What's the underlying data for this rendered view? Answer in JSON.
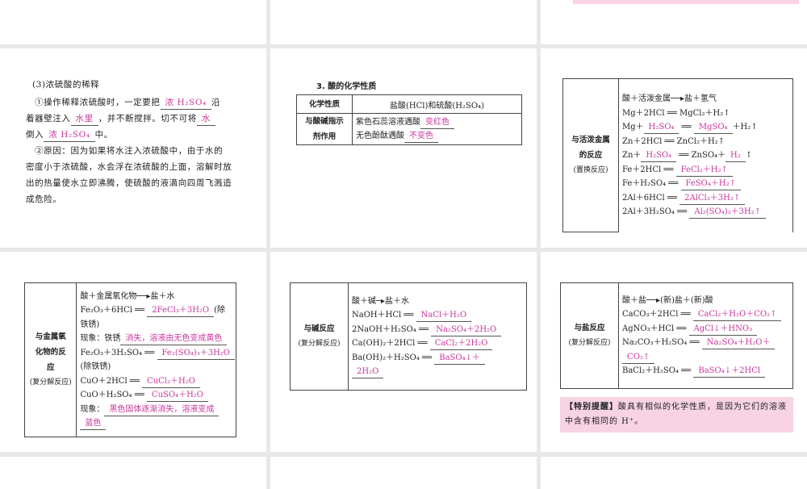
{
  "dilution": {
    "title": "(3)浓硫酸的稀释",
    "lines": [
      [
        {
          "t": "　①操作稀释浓硫酸时，一定要把"
        },
        {
          "b": "浓 H₂SO₄"
        },
        {
          "t": "沿"
        }
      ],
      [
        {
          "t": "着器壁注入"
        },
        {
          "b": "水里"
        },
        {
          "t": "，并不断搅拌。切不可将"
        },
        {
          "b": "水"
        }
      ],
      [
        {
          "t": "倒入"
        },
        {
          "b": "浓 H₂SO₄"
        },
        {
          "t": "中。"
        }
      ],
      [
        {
          "t": "　②原因：因为如果将水注入浓硫酸中，由于水的"
        }
      ],
      [
        {
          "t": "密度小于浓硫酸，水会浮在浓硫酸的上面，溶解时放"
        }
      ],
      [
        {
          "t": "出的热量使水立即沸腾，使硫酸的液滴向四周飞溅造"
        }
      ],
      [
        {
          "t": "成危险。"
        }
      ]
    ]
  },
  "props": {
    "heading": "3. 酸的化学性质",
    "col1": "化学性质",
    "col2": "盐酸(HCl)和硫酸(H₂SO₄)",
    "indicator_label": "与酸碱指示剂作用",
    "lines": [
      [
        {
          "t": "紫色石蕊溶液遇酸"
        },
        {
          "b": "变红色"
        }
      ],
      [
        {
          "t": "无色酚酞遇酸"
        },
        {
          "b": "不变色"
        }
      ]
    ]
  },
  "metal": {
    "label": "与活泼金属的反应",
    "sub": "(置换反应)",
    "lines": [
      [
        {
          "t": "酸＋活泼金属──▸盐＋氢气"
        }
      ],
      [
        {
          "t": "Mg＋2HCl ══ MgCl₂＋H₂↑"
        }
      ],
      [
        {
          "t": "Mg＋"
        },
        {
          "b": "H₂SO₄"
        },
        {
          "t": " ══ "
        },
        {
          "b": "MgSO₄"
        },
        {
          "t": "＋H₂↑"
        }
      ],
      [
        {
          "t": "Zn＋2HCl ══ ZnCl₂＋H₂↑"
        }
      ],
      [
        {
          "t": "Zn＋"
        },
        {
          "b": "H₂SO₄"
        },
        {
          "t": " ══ ZnSO₄＋"
        },
        {
          "b": "H₂"
        },
        {
          "t": "↑"
        }
      ],
      [
        {
          "t": "Fe＋2HCl ══ "
        },
        {
          "b": "FeCl₂＋H₂↑"
        }
      ],
      [
        {
          "t": "Fe＋H₂SO₄ ══ "
        },
        {
          "b": "FeSO₄＋H₂↑"
        }
      ],
      [
        {
          "t": "2Al＋6HCl ══ "
        },
        {
          "b": "2AlCl₃＋3H₂↑"
        }
      ],
      [
        {
          "t": "2Al＋3H₂SO₄ ══ "
        },
        {
          "b": "Al₂(SO₄)₃＋3H₂↑"
        }
      ]
    ]
  },
  "oxide": {
    "label": "与金属氧化物的反应",
    "sub": "(复分解反应)",
    "lines": [
      [
        {
          "t": "酸＋金属氧化物──▸盐＋水"
        }
      ],
      [
        {
          "t": "Fe₂O₃＋6HCl ══ "
        },
        {
          "b": "2FeCl₃＋3H₂O"
        },
        {
          "t": "(除"
        }
      ],
      [
        {
          "t": "铁锈)"
        }
      ],
      [
        {
          "t": "现象：铁锈"
        },
        {
          "b": "消失，溶液由无色变成黄色"
        }
      ],
      [
        {
          "t": "Fe₂O₃＋3H₂SO₄ ══ "
        },
        {
          "b": "Fe₂(SO₄)₃＋3H₂O"
        }
      ],
      [
        {
          "t": "(除铁锈)"
        }
      ],
      [
        {
          "t": "CuO＋2HCl ══ "
        },
        {
          "b": "CuCl₂＋H₂O"
        }
      ],
      [
        {
          "t": "CuO＋H₂SO₄ ══ "
        },
        {
          "b": "CuSO₄＋H₂O"
        }
      ],
      [
        {
          "t": "现象："
        },
        {
          "b": "黑色固体逐渐消失，溶液变成"
        }
      ],
      [
        {
          "b": "蓝色"
        }
      ]
    ]
  },
  "base": {
    "label": "与碱反应",
    "sub": "(复分解反应)",
    "lines": [
      [
        {
          "t": "酸＋碱─▸盐＋水"
        }
      ],
      [
        {
          "t": "NaOH＋HCl ══ "
        },
        {
          "b": "NaCl＋H₂O"
        }
      ],
      [
        {
          "t": "2NaOH＋H₂SO₄ ══ "
        },
        {
          "b": "Na₂SO₄＋2H₂O"
        }
      ],
      [
        {
          "t": "Ca(OH)₂＋2HCl ══ "
        },
        {
          "b": "CaCl₂＋2H₂O"
        }
      ],
      [
        {
          "t": "Ba(OH)₂＋H₂SO₄ ══ "
        },
        {
          "b": "BaSO₄↓＋"
        }
      ],
      [
        {
          "b": "2H₂O"
        }
      ]
    ]
  },
  "salt": {
    "label": "与盐反应",
    "sub": "(复分解反应)",
    "lines": [
      [
        {
          "t": "酸＋盐──▸(新)盐＋(新)酸"
        }
      ],
      [
        {
          "t": "CaCO₃＋2HCl ══ "
        },
        {
          "b": "CaCl₂＋H₂O＋CO₂↑"
        }
      ],
      [
        {
          "t": "AgNO₃＋HCl ══ "
        },
        {
          "b": "AgCl↓＋HNO₃"
        }
      ],
      [
        {
          "t": "Na₂CO₃＋H₂SO₄ ══ "
        },
        {
          "b": "Na₂SO₄＋H₂O＋"
        }
      ],
      [
        {
          "b": "CO₂↑"
        }
      ],
      [
        {
          "t": "BaCl₂＋H₂SO₄ ══ "
        },
        {
          "b": "BaSO₄↓＋2HCl"
        }
      ]
    ],
    "tip_title": "【特别提醒】",
    "tip_text": "酸具有相似的化学性质，是因为它们的溶液中含有相同的 H⁺。"
  }
}
